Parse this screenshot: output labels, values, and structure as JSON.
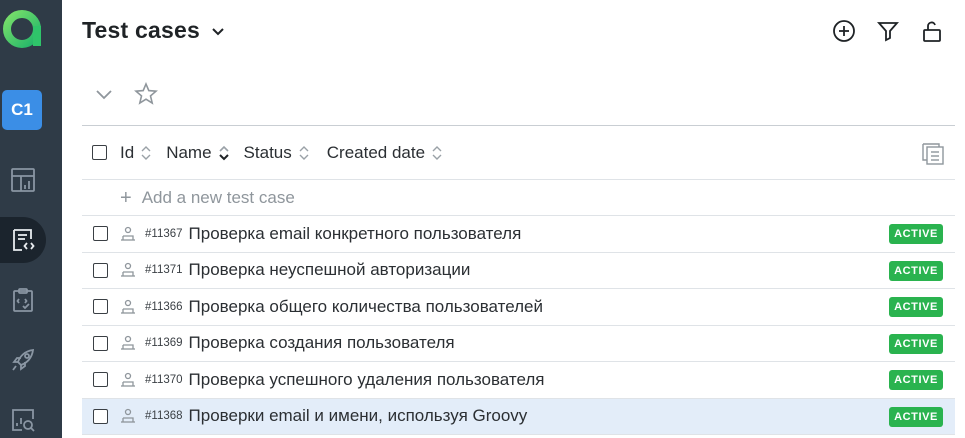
{
  "app": {
    "logo_letter": "a"
  },
  "sidebar": {
    "project_badge": "C1",
    "items": [
      {
        "name": "dashboards",
        "icon": "dashboard-icon"
      },
      {
        "name": "test-cases",
        "icon": "test-cases-icon",
        "active": true
      },
      {
        "name": "test-plans",
        "icon": "clipboard-icon"
      },
      {
        "name": "launches",
        "icon": "rocket-icon"
      },
      {
        "name": "analytics",
        "icon": "analytics-icon"
      }
    ]
  },
  "header": {
    "title": "Test cases",
    "actions": [
      "add-icon",
      "filter-icon",
      "lock-icon"
    ]
  },
  "table": {
    "columns": {
      "id": "Id",
      "name": "Name",
      "status": "Status",
      "created": "Created date"
    },
    "add_placeholder": "Add a new test case",
    "rows": [
      {
        "id": "#11367",
        "name": "Проверка email конкретного пользователя",
        "status": "ACTIVE"
      },
      {
        "id": "#11371",
        "name": "Проверка неуспешной авторизации",
        "status": "ACTIVE"
      },
      {
        "id": "#11366",
        "name": "Проверка общего количества пользователей",
        "status": "ACTIVE"
      },
      {
        "id": "#11369",
        "name": "Проверка создания пользователя",
        "status": "ACTIVE"
      },
      {
        "id": "#11370",
        "name": "Проверка успешного удаления пользователя",
        "status": "ACTIVE"
      },
      {
        "id": "#11368",
        "name": "Проверки email и имени, используя Groovy",
        "status": "ACTIVE",
        "selected": true
      }
    ]
  },
  "colors": {
    "sidebar": "#2f3b47",
    "accent": "#3b8ee6",
    "status_active": "#2ab34f",
    "selected_row": "#e3edf9"
  }
}
